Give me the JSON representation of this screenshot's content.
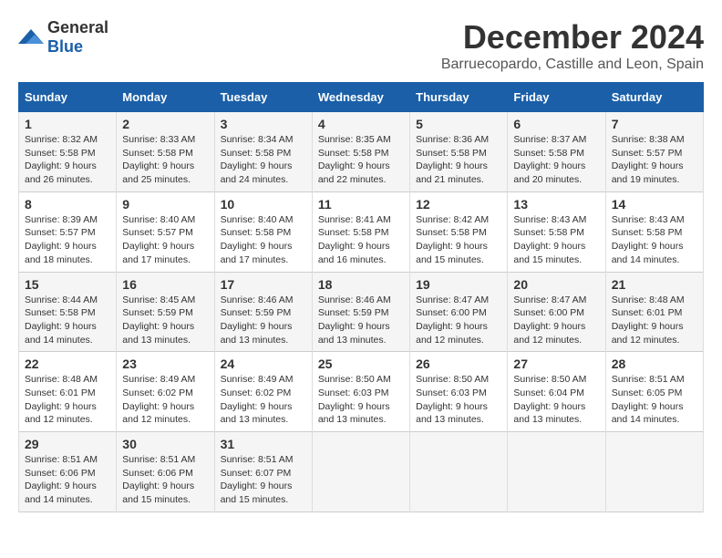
{
  "logo": {
    "general": "General",
    "blue": "Blue"
  },
  "title": "December 2024",
  "subtitle": "Barruecopardo, Castille and Leon, Spain",
  "days_header": [
    "Sunday",
    "Monday",
    "Tuesday",
    "Wednesday",
    "Thursday",
    "Friday",
    "Saturday"
  ],
  "weeks": [
    [
      {
        "day": "1",
        "info": "Sunrise: 8:32 AM\nSunset: 5:58 PM\nDaylight: 9 hours and 26 minutes."
      },
      {
        "day": "2",
        "info": "Sunrise: 8:33 AM\nSunset: 5:58 PM\nDaylight: 9 hours and 25 minutes."
      },
      {
        "day": "3",
        "info": "Sunrise: 8:34 AM\nSunset: 5:58 PM\nDaylight: 9 hours and 24 minutes."
      },
      {
        "day": "4",
        "info": "Sunrise: 8:35 AM\nSunset: 5:58 PM\nDaylight: 9 hours and 22 minutes."
      },
      {
        "day": "5",
        "info": "Sunrise: 8:36 AM\nSunset: 5:58 PM\nDaylight: 9 hours and 21 minutes."
      },
      {
        "day": "6",
        "info": "Sunrise: 8:37 AM\nSunset: 5:58 PM\nDaylight: 9 hours and 20 minutes."
      },
      {
        "day": "7",
        "info": "Sunrise: 8:38 AM\nSunset: 5:57 PM\nDaylight: 9 hours and 19 minutes."
      }
    ],
    [
      {
        "day": "8",
        "info": "Sunrise: 8:39 AM\nSunset: 5:57 PM\nDaylight: 9 hours and 18 minutes."
      },
      {
        "day": "9",
        "info": "Sunrise: 8:40 AM\nSunset: 5:57 PM\nDaylight: 9 hours and 17 minutes."
      },
      {
        "day": "10",
        "info": "Sunrise: 8:40 AM\nSunset: 5:58 PM\nDaylight: 9 hours and 17 minutes."
      },
      {
        "day": "11",
        "info": "Sunrise: 8:41 AM\nSunset: 5:58 PM\nDaylight: 9 hours and 16 minutes."
      },
      {
        "day": "12",
        "info": "Sunrise: 8:42 AM\nSunset: 5:58 PM\nDaylight: 9 hours and 15 minutes."
      },
      {
        "day": "13",
        "info": "Sunrise: 8:43 AM\nSunset: 5:58 PM\nDaylight: 9 hours and 15 minutes."
      },
      {
        "day": "14",
        "info": "Sunrise: 8:43 AM\nSunset: 5:58 PM\nDaylight: 9 hours and 14 minutes."
      }
    ],
    [
      {
        "day": "15",
        "info": "Sunrise: 8:44 AM\nSunset: 5:58 PM\nDaylight: 9 hours and 14 minutes."
      },
      {
        "day": "16",
        "info": "Sunrise: 8:45 AM\nSunset: 5:59 PM\nDaylight: 9 hours and 13 minutes."
      },
      {
        "day": "17",
        "info": "Sunrise: 8:46 AM\nSunset: 5:59 PM\nDaylight: 9 hours and 13 minutes."
      },
      {
        "day": "18",
        "info": "Sunrise: 8:46 AM\nSunset: 5:59 PM\nDaylight: 9 hours and 13 minutes."
      },
      {
        "day": "19",
        "info": "Sunrise: 8:47 AM\nSunset: 6:00 PM\nDaylight: 9 hours and 12 minutes."
      },
      {
        "day": "20",
        "info": "Sunrise: 8:47 AM\nSunset: 6:00 PM\nDaylight: 9 hours and 12 minutes."
      },
      {
        "day": "21",
        "info": "Sunrise: 8:48 AM\nSunset: 6:01 PM\nDaylight: 9 hours and 12 minutes."
      }
    ],
    [
      {
        "day": "22",
        "info": "Sunrise: 8:48 AM\nSunset: 6:01 PM\nDaylight: 9 hours and 12 minutes."
      },
      {
        "day": "23",
        "info": "Sunrise: 8:49 AM\nSunset: 6:02 PM\nDaylight: 9 hours and 12 minutes."
      },
      {
        "day": "24",
        "info": "Sunrise: 8:49 AM\nSunset: 6:02 PM\nDaylight: 9 hours and 13 minutes."
      },
      {
        "day": "25",
        "info": "Sunrise: 8:50 AM\nSunset: 6:03 PM\nDaylight: 9 hours and 13 minutes."
      },
      {
        "day": "26",
        "info": "Sunrise: 8:50 AM\nSunset: 6:03 PM\nDaylight: 9 hours and 13 minutes."
      },
      {
        "day": "27",
        "info": "Sunrise: 8:50 AM\nSunset: 6:04 PM\nDaylight: 9 hours and 13 minutes."
      },
      {
        "day": "28",
        "info": "Sunrise: 8:51 AM\nSunset: 6:05 PM\nDaylight: 9 hours and 14 minutes."
      }
    ],
    [
      {
        "day": "29",
        "info": "Sunrise: 8:51 AM\nSunset: 6:06 PM\nDaylight: 9 hours and 14 minutes."
      },
      {
        "day": "30",
        "info": "Sunrise: 8:51 AM\nSunset: 6:06 PM\nDaylight: 9 hours and 15 minutes."
      },
      {
        "day": "31",
        "info": "Sunrise: 8:51 AM\nSunset: 6:07 PM\nDaylight: 9 hours and 15 minutes."
      },
      null,
      null,
      null,
      null
    ]
  ]
}
